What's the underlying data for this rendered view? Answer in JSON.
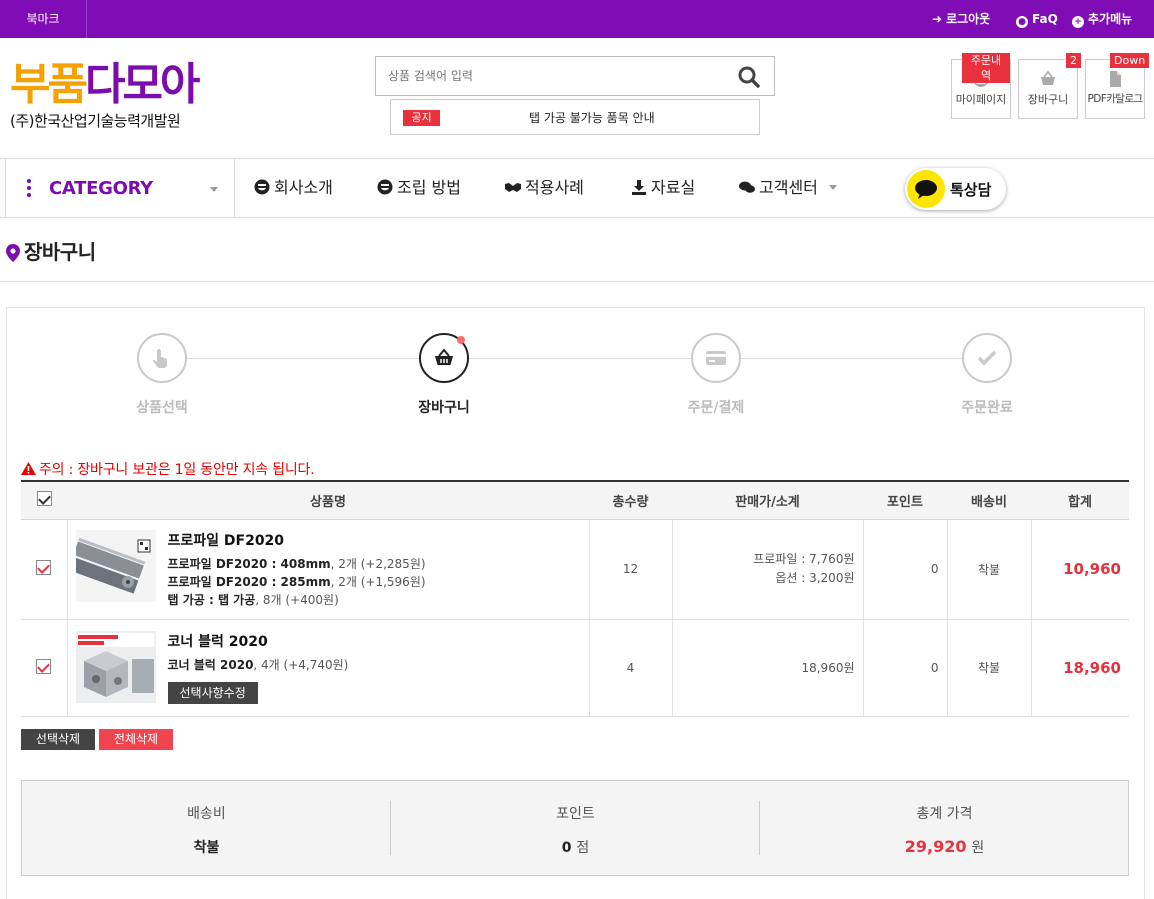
{
  "topbar": {
    "bookmark": "북마크",
    "logout": "로그아웃",
    "faq": "FaQ",
    "more": "추가메뉴"
  },
  "logo": {
    "brand_part1": "부품",
    "brand_part2": "다모아",
    "company": "(주)한국산업기술능력개발원"
  },
  "search": {
    "placeholder": "상품 검색어 입력"
  },
  "notice": {
    "tag": "공지",
    "text": "탭 가공 불가능 품목 안내"
  },
  "quick": [
    {
      "badge": "주문내역",
      "label": "마이페이지",
      "icon": "user-icon"
    },
    {
      "badge": "2",
      "label": "장바구니",
      "icon": "basket-icon"
    },
    {
      "badge": "Down",
      "label": "PDF카탈로그",
      "icon": "pdf-icon"
    }
  ],
  "nav": {
    "category": "CATEGORY",
    "items": [
      {
        "label": "회사소개",
        "icon": "smile-icon"
      },
      {
        "label": "조립 방법",
        "icon": "smile-icon"
      },
      {
        "label": "적용사례",
        "icon": "handshake-icon"
      },
      {
        "label": "자료실",
        "icon": "download-icon"
      },
      {
        "label": "고객센터",
        "icon": "chat-icon"
      }
    ],
    "kakao": "톡상담"
  },
  "page": {
    "title": "장바구니"
  },
  "steps": [
    {
      "label": "상품선택",
      "icon": "hand-icon",
      "active": false
    },
    {
      "label": "장바구니",
      "icon": "basket-icon",
      "active": true
    },
    {
      "label": "주문/결제",
      "icon": "card-icon",
      "active": false
    },
    {
      "label": "주문완료",
      "icon": "check-icon",
      "active": false
    }
  ],
  "warning": "주의 : 장바구니 보관은 1일 동안만 지속 됩니다.",
  "table": {
    "headers": [
      "상품명",
      "총수량",
      "판매가/소계",
      "포인트",
      "배송비",
      "합계"
    ],
    "rows": [
      {
        "name": "프로파일 DF2020",
        "options": [
          {
            "bold": "프로파일 DF2020 : 408mm",
            "rest": ", 2개 (+2,285원)"
          },
          {
            "bold": "프로파일 DF2020 : 285mm",
            "rest": ", 2개 (+1,596원)"
          },
          {
            "bold": "탭 가공 : 탭 가공",
            "rest": ", 8개 (+400원)"
          }
        ],
        "qty": "12",
        "price_lines": [
          "프로파일 : 7,760원",
          "옵션 : 3,200원"
        ],
        "point": "0",
        "shipping": "착불",
        "total": "10,960"
      },
      {
        "name": "코너 블럭 2020",
        "options": [
          {
            "bold": "코너 블럭 2020",
            "rest": ", 4개 (+4,740원)"
          }
        ],
        "edit_label": "선택사항수정",
        "qty": "4",
        "price_lines": [
          "18,960원"
        ],
        "point": "0",
        "shipping": "착불",
        "total": "18,960"
      }
    ]
  },
  "buttons": {
    "delete_selected": "선택삭제",
    "delete_all": "전체삭제"
  },
  "summary": {
    "shipping_label": "배송비",
    "shipping_value": "착불",
    "point_label": "포인트",
    "point_value": "0",
    "point_unit": "점",
    "total_label": "총계 가격",
    "total_value": "29,920",
    "total_unit": "원"
  },
  "colors": {
    "brand_purple": "#7f0cb5",
    "brand_orange": "#f5a200",
    "accent_red": "#e8313d",
    "kakao_yellow": "#fee500"
  }
}
